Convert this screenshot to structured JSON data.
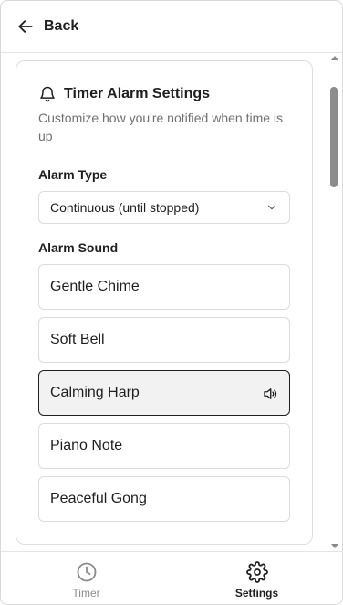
{
  "header": {
    "back_label": "Back",
    "back_icon": "arrow-left-icon"
  },
  "card": {
    "title": "Timer Alarm Settings",
    "title_icon": "bell-icon",
    "description": "Customize how you're notified when time is up",
    "alarm_type": {
      "label": "Alarm Type",
      "selected": "Continuous (until stopped)"
    },
    "alarm_sound": {
      "label": "Alarm Sound",
      "options": [
        {
          "label": "Gentle Chime",
          "selected": false
        },
        {
          "label": "Soft Bell",
          "selected": false
        },
        {
          "label": "Calming Harp",
          "selected": true
        },
        {
          "label": "Piano Note",
          "selected": false
        },
        {
          "label": "Peaceful Gong",
          "selected": false
        }
      ]
    }
  },
  "nav": {
    "items": [
      {
        "label": "Timer",
        "icon": "clock-icon",
        "active": false
      },
      {
        "label": "Settings",
        "icon": "gear-icon",
        "active": true
      }
    ]
  },
  "colors": {
    "text": "#1f1f1f",
    "muted": "#707070",
    "selected_bg": "#f2f2f2",
    "inactive": "#8a8a8a"
  }
}
